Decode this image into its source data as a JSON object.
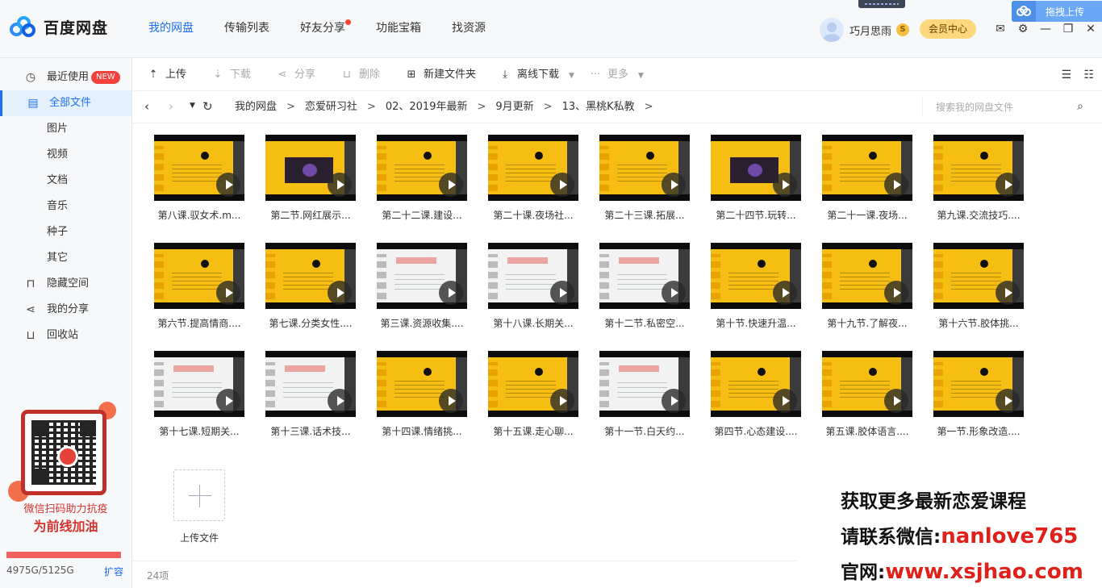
{
  "app": {
    "title": "百度网盘"
  },
  "nav": [
    {
      "label": "我的网盘",
      "active": true
    },
    {
      "label": "传输列表"
    },
    {
      "label": "好友分享",
      "dot": true
    },
    {
      "label": "功能宝箱"
    },
    {
      "label": "找资源"
    }
  ],
  "user": {
    "name": "巧月思雨",
    "badge": "S",
    "vip_label": "会员中心"
  },
  "upload_float": {
    "label": "拖拽上传"
  },
  "sidebar": {
    "items": [
      {
        "label": "最近使用",
        "icon": "clock-icon",
        "glyph": "◷",
        "badge": "NEW"
      },
      {
        "label": "全部文件",
        "icon": "file-icon",
        "glyph": "▤",
        "active": true
      },
      {
        "label": "图片",
        "sub": true
      },
      {
        "label": "视频",
        "sub": true
      },
      {
        "label": "文档",
        "sub": true
      },
      {
        "label": "音乐",
        "sub": true
      },
      {
        "label": "种子",
        "sub": true
      },
      {
        "label": "其它",
        "sub": true
      },
      {
        "label": "隐藏空间",
        "icon": "lock-icon",
        "glyph": "⊓"
      },
      {
        "label": "我的分享",
        "icon": "share-icon",
        "glyph": "⋖"
      },
      {
        "label": "回收站",
        "icon": "trash-icon",
        "glyph": "⊔"
      }
    ],
    "promo": {
      "line1": "微信扫码助力抗疫",
      "line2": "为前线加油"
    },
    "quota": {
      "text": "4975G/5125G",
      "used_fraction": 0.971,
      "expand": "扩容"
    }
  },
  "toolbar": {
    "upload": "上传",
    "download": "下载",
    "share": "分享",
    "delete": "删除",
    "new_folder": "新建文件夹",
    "offline": "离线下载",
    "more": "更多"
  },
  "breadcrumb": [
    "我的网盘",
    "恋爱研习社",
    "02、2019年最新",
    "9月更新",
    "13、黑桃K私教"
  ],
  "search": {
    "placeholder": "搜索我的网盘文件"
  },
  "files": [
    {
      "name": "第八课.驭女术.m...",
      "style": "yellow"
    },
    {
      "name": "第二节.网红展示...",
      "style": "photo"
    },
    {
      "name": "第二十二课.建设...",
      "style": "yellow"
    },
    {
      "name": "第二十课.夜场社...",
      "style": "yellow"
    },
    {
      "name": "第二十三课.拓展...",
      "style": "yellow"
    },
    {
      "name": "第二十四节.玩转...",
      "style": "photo"
    },
    {
      "name": "第二十一课.夜场...",
      "style": "yellow"
    },
    {
      "name": "第九课.交流技巧....",
      "style": "yellow"
    },
    {
      "name": "第六节.提高情商....",
      "style": "yellow"
    },
    {
      "name": "第七课.分类女性....",
      "style": "yellow"
    },
    {
      "name": "第三课.资源收集....",
      "style": "white"
    },
    {
      "name": "第十八课.长期关...",
      "style": "white"
    },
    {
      "name": "第十二节.私密空...",
      "style": "white"
    },
    {
      "name": "第十节.快速升温...",
      "style": "yellow"
    },
    {
      "name": "第十九节.了解夜...",
      "style": "yellow"
    },
    {
      "name": "第十六节.胶体挑...",
      "style": "yellow"
    },
    {
      "name": "第十七课.短期关...",
      "style": "white"
    },
    {
      "name": "第十三课.话术技...",
      "style": "white"
    },
    {
      "name": "第十四课.情绪挑...",
      "style": "yellow"
    },
    {
      "name": "第十五课.走心聊...",
      "style": "yellow"
    },
    {
      "name": "第十一节.白天约...",
      "style": "white"
    },
    {
      "name": "第四节.心态建设....",
      "style": "yellow"
    },
    {
      "name": "第五课.胶体语言....",
      "style": "yellow"
    },
    {
      "name": "第一节.形象改造....",
      "style": "yellow"
    }
  ],
  "add_file": {
    "label": "上传文件"
  },
  "status": {
    "count": "24项"
  },
  "overlay": {
    "line1": "获取更多最新恋爱课程",
    "line2_prefix": "请联系微信:",
    "line2_value": "nanlove765",
    "line3_prefix": "官网:",
    "line3_value": "www.xsjhao.com"
  }
}
